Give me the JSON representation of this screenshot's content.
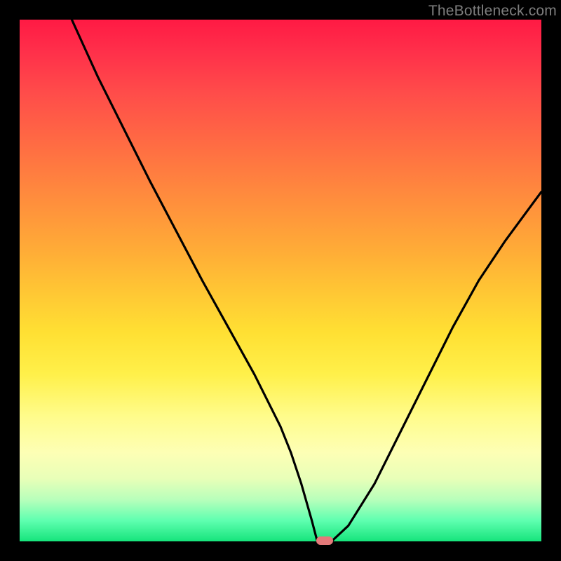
{
  "watermark": "TheBottleneck.com",
  "chart_data": {
    "type": "line",
    "title": "",
    "xlabel": "",
    "ylabel": "",
    "xlim": [
      0,
      100
    ],
    "ylim": [
      0,
      100
    ],
    "grid": false,
    "legend": false,
    "series": [
      {
        "name": "curve",
        "x": [
          10,
          15,
          20,
          25,
          30,
          35,
          40,
          45,
          50,
          52,
          54,
          56,
          57,
          60,
          63,
          68,
          73,
          78,
          83,
          88,
          93,
          100
        ],
        "values": [
          100,
          89,
          79,
          69,
          59.5,
          50,
          41,
          32,
          22,
          17,
          11,
          4,
          0.2,
          0.2,
          3,
          11,
          21,
          31,
          41,
          50,
          57.5,
          67
        ]
      }
    ],
    "marker": {
      "x": 58.5,
      "y": 0.2,
      "color": "#e47a7a"
    },
    "gradient_stops": [
      {
        "pos": 0,
        "color": "#ff1a44"
      },
      {
        "pos": 34,
        "color": "#ff8c3d"
      },
      {
        "pos": 60,
        "color": "#ffe033"
      },
      {
        "pos": 83,
        "color": "#fdffb5"
      },
      {
        "pos": 96,
        "color": "#5fffb0"
      },
      {
        "pos": 100,
        "color": "#16e47c"
      }
    ]
  }
}
